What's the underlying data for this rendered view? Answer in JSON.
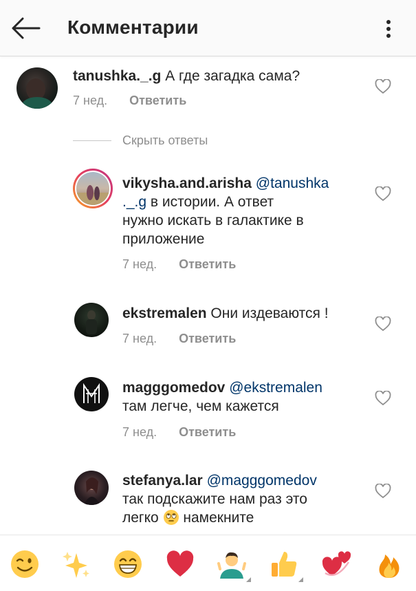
{
  "header": {
    "title": "Комментарии",
    "back_icon": "arrow-left-icon",
    "menu_icon": "more-vertical-icon"
  },
  "hide_replies_label": "Скрыть ответы",
  "comments": [
    {
      "username": "tanushka._.g",
      "text": "А где загадка сама?",
      "time": "7 нед.",
      "reply_label": "Ответить"
    },
    {
      "username": "vikysha.and.arisha",
      "mention": "@tanushka",
      "mention_cont": "._.g",
      "text": "в истории. А ответ",
      "text2": "нужно искать в галактике в",
      "text3": "приложение",
      "time": "7 нед.",
      "reply_label": "Ответить"
    },
    {
      "username": "ekstremalen",
      "text": "Они издеваются !",
      "time": "7 нед.",
      "reply_label": "Ответить"
    },
    {
      "username": "magggomedov",
      "mention": "@ekstremalen",
      "text": "там легче, чем кажется",
      "time": "7 нед.",
      "reply_label": "Ответить"
    },
    {
      "username": "stefanya.lar",
      "mention": "@magggomedov",
      "text": "так подскажите нам раз это",
      "text2": "легко",
      "text3": "намекните"
    }
  ],
  "emoji_bar": [
    "winking-face-icon",
    "sparkles-icon",
    "grinning-face-icon",
    "red-heart-icon",
    "person-shrugging-icon",
    "thumbs-up-icon",
    "revolving-hearts-icon",
    "fire-icon"
  ],
  "colors": {
    "text": "#262626",
    "secondary": "#8e8e8e",
    "mention": "#003569",
    "story_ring": "#e4405f"
  }
}
